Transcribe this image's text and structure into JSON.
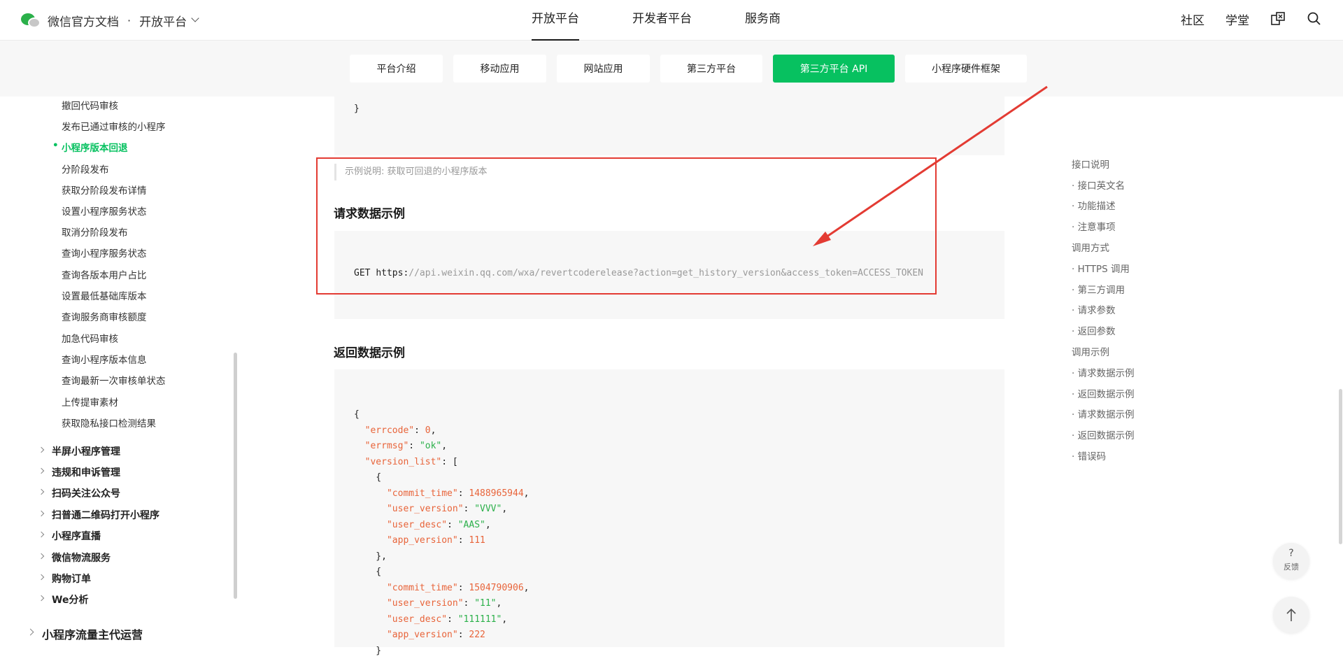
{
  "header": {
    "brand": "微信官方文档",
    "dot": "·",
    "platform": "开放平台",
    "nav": [
      "开放平台",
      "开发者平台",
      "服务商"
    ],
    "right_links": [
      "社区",
      "学堂"
    ],
    "icons": [
      "translate-icon",
      "search-icon"
    ]
  },
  "subnav": {
    "tabs": [
      "平台介绍",
      "移动应用",
      "网站应用",
      "第三方平台",
      "第三方平台 API",
      "小程序硬件框架"
    ],
    "active": "第三方平台 API"
  },
  "sidebar": {
    "items": [
      "撤回代码审核",
      "发布已通过审核的小程序",
      "小程序版本回退",
      "分阶段发布",
      "获取分阶段发布详情",
      "设置小程序服务状态",
      "取消分阶段发布",
      "查询小程序服务状态",
      "查询各版本用户占比",
      "设置最低基础库版本",
      "查询服务商审核额度",
      "加急代码审核",
      "查询小程序版本信息",
      "查询最新一次审核单状态",
      "上传提审素材",
      "获取隐私接口检测结果"
    ],
    "active_item": "小程序版本回退",
    "groups": [
      "半屏小程序管理",
      "违规和申诉管理",
      "扫码关注公众号",
      "扫普通二维码打开小程序",
      "小程序直播",
      "微信物流服务",
      "购物订单",
      "We分析"
    ],
    "top_group": "小程序流量主代运营"
  },
  "content": {
    "prev_code_closing": "}",
    "note": "示例说明: 获取可回退的小程序版本",
    "request_title": "请求数据示例",
    "request_method": "GET",
    "request_scheme": "https:",
    "request_url": "//api.weixin.qq.com/wxa/revertcoderelease?action=get_history_version&access_token=ACCESS_TOKEN",
    "response_title": "返回数据示例",
    "response": {
      "errcode_key": "\"errcode\"",
      "errcode_val": "0",
      "errmsg_key": "\"errmsg\"",
      "errmsg_val": "\"ok\"",
      "version_list_key": "\"version_list\"",
      "v1": {
        "commit_time": "1488965944",
        "user_version": "\"VVV\"",
        "user_desc": "\"AAS\"",
        "app_version": "111"
      },
      "v2": {
        "commit_time": "1504790906",
        "user_version": "\"11\"",
        "user_desc": "\"111111\"",
        "app_version": "222"
      },
      "k_commit_time": "\"commit_time\"",
      "k_user_version": "\"user_version\"",
      "k_user_desc": "\"user_desc\"",
      "k_app_version": "\"app_version\""
    }
  },
  "toc": {
    "items": [
      "接口说明",
      "· 接口英文名",
      "· 功能描述",
      "· 注意事项",
      "调用方式",
      "· HTTPS 调用",
      "· 第三方调用",
      "· 请求参数",
      "· 返回参数",
      "调用示例",
      "· 请求数据示例",
      "· 返回数据示例",
      "· 请求数据示例",
      "· 返回数据示例",
      "· 错误码"
    ]
  },
  "floating": {
    "feedback_symbol": "?",
    "feedback_label": "反馈",
    "top_icon": "arrow-up-icon"
  },
  "colors": {
    "accent": "#07c160",
    "annotation": "#e33b33",
    "code_key": "#e8643a",
    "code_string": "#2bb04a"
  }
}
